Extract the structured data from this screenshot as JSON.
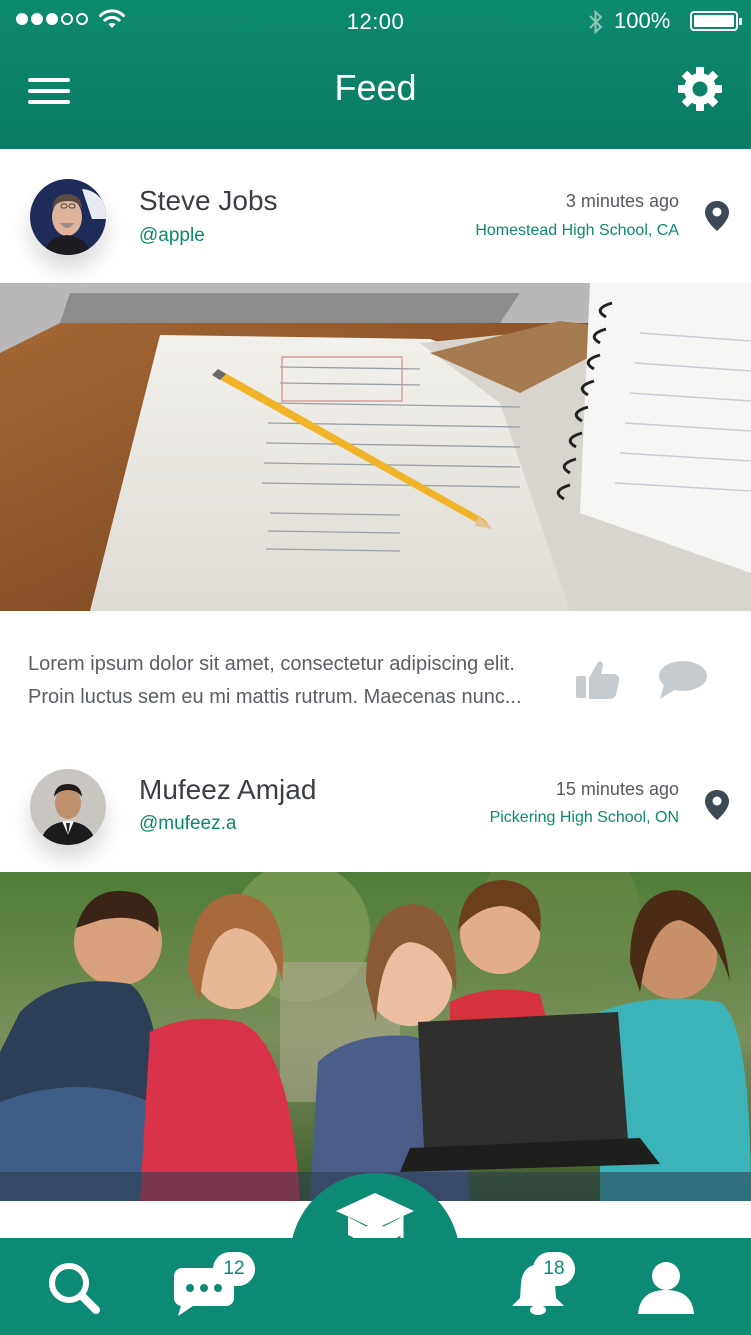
{
  "status_bar": {
    "time": "12:00",
    "battery": "100%"
  },
  "header": {
    "title": "Feed"
  },
  "posts": [
    {
      "author": "Steve Jobs",
      "handle": "@apple",
      "time": "3 minutes ago",
      "location": "Homestead High School, CA",
      "text_line1": "Lorem ipsum dolor sit amet, consectetur adipiscing elit.",
      "text_line2": "Proin luctus sem eu mi mattis rutrum. Maecenas nunc..."
    },
    {
      "author": "Mufeez Amjad",
      "handle": "@mufeez.a",
      "time": "15 minutes ago",
      "location": "Pickering High School, ON"
    }
  ],
  "tabbar": {
    "messages_badge": "12",
    "notifications_badge": "18"
  },
  "colors": {
    "brand": "#0d8a6e",
    "tabbar": "#0d8a73"
  },
  "icons": [
    "hamburger-menu-icon",
    "gear-icon",
    "location-pin-icon",
    "thumbs-up-icon",
    "speech-bubble-icon",
    "search-icon",
    "chat-icon",
    "graduate-icon",
    "bell-icon",
    "user-icon"
  ]
}
